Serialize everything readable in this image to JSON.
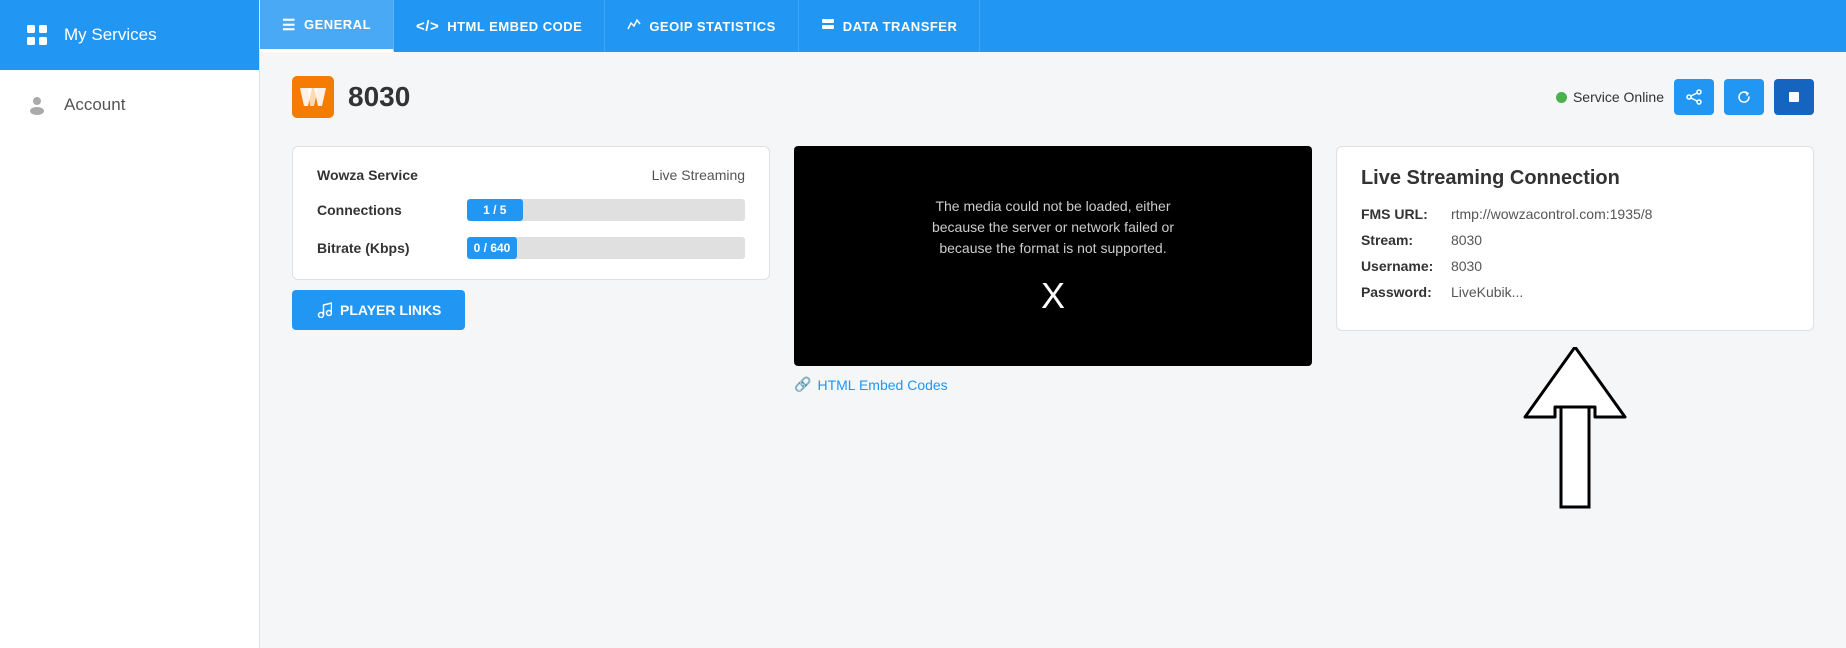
{
  "sidebar": {
    "items": [
      {
        "id": "my-services",
        "label": "My Services",
        "icon": "grid",
        "active": true
      },
      {
        "id": "account",
        "label": "Account",
        "icon": "person",
        "active": false
      }
    ]
  },
  "tabs": [
    {
      "id": "general",
      "label": "General",
      "icon": "☰",
      "active": true
    },
    {
      "id": "html-embed",
      "label": "HTML Embed Code",
      "icon": "</>",
      "active": false
    },
    {
      "id": "geoip",
      "label": "GeoIP Statistics",
      "icon": "📈",
      "active": false
    },
    {
      "id": "data-transfer",
      "label": "Data Transfer",
      "icon": "⇄",
      "active": false
    }
  ],
  "service": {
    "name": "8030",
    "status": "Service Online",
    "status_color": "#4CAF50"
  },
  "info": {
    "wowza_service_label": "Wowza Service",
    "wowza_service_value": "Live Streaming",
    "connections_label": "Connections",
    "connections_current": 1,
    "connections_max": 5,
    "connections_pct": 20,
    "connections_bar_text": "1 / 5",
    "bitrate_label": "Bitrate (Kbps)",
    "bitrate_current": 0,
    "bitrate_max": 640,
    "bitrate_bar_text": "0 / 640",
    "bitrate_pct": 1
  },
  "video": {
    "error_text": "The media could not be loaded, either because the server or network failed or because the format is not supported.",
    "x_symbol": "X"
  },
  "embed_link": {
    "label": "HTML Embed Codes",
    "icon": "🔗"
  },
  "connection": {
    "title": "Live Streaming Connection",
    "fms_url_label": "FMS URL:",
    "fms_url_value": "rtmp://wowzacontrol.com:1935/8",
    "stream_label": "Stream:",
    "stream_value": "8030",
    "username_label": "Username:",
    "username_value": "8030",
    "password_label": "Password:",
    "password_value": "LiveKubik..."
  },
  "buttons": {
    "player_links": "PLAYER LINKS",
    "share_icon": "share",
    "refresh_icon": "refresh",
    "stop_icon": "stop"
  }
}
